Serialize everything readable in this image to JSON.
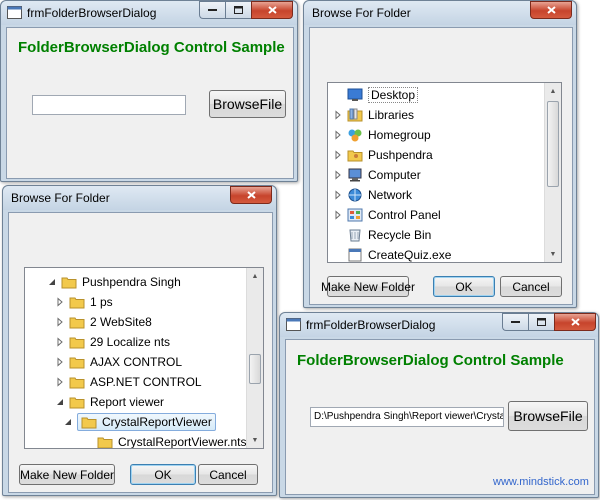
{
  "windows": {
    "form_top": {
      "title": "frmFolderBrowserDialog",
      "heading": "FolderBrowserDialog  Control Sample",
      "path_value": "",
      "browse_label": "BrowseFile"
    },
    "browse_right": {
      "title": "Browse For Folder",
      "tree_items": [
        {
          "label": "Desktop",
          "icon": "desktop-icon"
        },
        {
          "label": "Libraries",
          "icon": "libraries-icon"
        },
        {
          "label": "Homegroup",
          "icon": "homegroup-icon"
        },
        {
          "label": "Pushpendra",
          "icon": "user-folder-icon"
        },
        {
          "label": "Computer",
          "icon": "computer-icon"
        },
        {
          "label": "Network",
          "icon": "network-icon"
        },
        {
          "label": "Control Panel",
          "icon": "control-panel-icon"
        },
        {
          "label": "Recycle Bin",
          "icon": "recycle-bin-icon"
        },
        {
          "label": "CreateQuiz.exe",
          "icon": "file-icon"
        }
      ],
      "make_new_folder": "Make New Folder",
      "ok": "OK",
      "cancel": "Cancel"
    },
    "browse_left": {
      "title": "Browse For Folder",
      "tree_items": [
        {
          "label": "Pushpendra Singh",
          "icon": "folder-icon"
        },
        {
          "label": "1 ps",
          "icon": "folder-icon"
        },
        {
          "label": "2 WebSite8",
          "icon": "folder-icon"
        },
        {
          "label": "29 Localize nts",
          "icon": "folder-icon"
        },
        {
          "label": "AJAX CONTROL",
          "icon": "folder-icon"
        },
        {
          "label": "ASP.NET CONTROL",
          "icon": "folder-icon"
        },
        {
          "label": "Report viewer",
          "icon": "folder-icon"
        },
        {
          "label": "CrystalReportViewer",
          "icon": "folder-icon"
        },
        {
          "label": "CrystalReportViewer.nts",
          "icon": "folder-icon"
        }
      ],
      "make_new_folder": "Make New Folder",
      "ok": "OK",
      "cancel": "Cancel"
    },
    "form_bottom": {
      "title": "frmFolderBrowserDialog",
      "heading": "FolderBrowserDialog  Control Sample",
      "path_value": "D:\\Pushpendra Singh\\Report viewer\\CrystalRep",
      "browse_label": "BrowseFile"
    }
  },
  "watermark": "www.mindstick.com",
  "colors": {
    "heading_green": "#008000",
    "selection_blue": "#d5eaf8",
    "folder_yellow": "#f2c94c",
    "close_red": "#c7442c"
  }
}
